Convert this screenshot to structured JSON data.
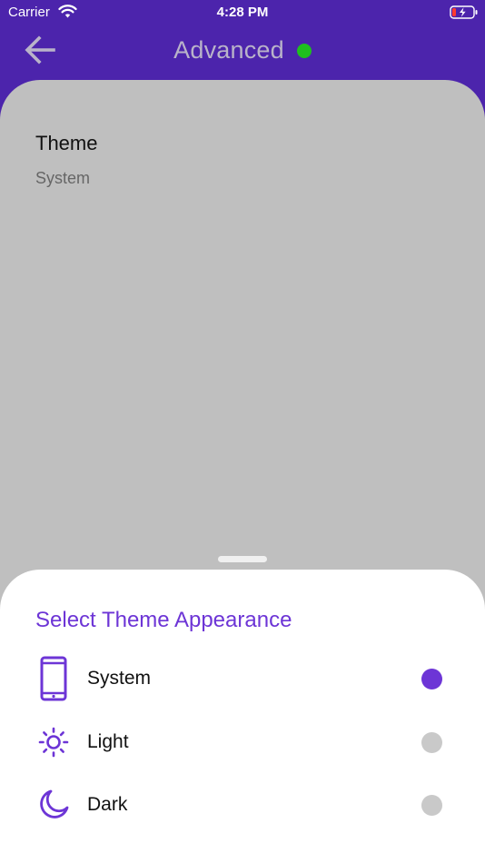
{
  "status_bar": {
    "carrier": "Carrier",
    "time": "4:28 PM",
    "wifi_icon": "wifi-icon",
    "battery_icon": "battery-charging-icon"
  },
  "header": {
    "title": "Advanced",
    "back_icon": "arrow-left-icon",
    "status_dot_color": "#1fbf1f"
  },
  "settings": {
    "theme": {
      "title": "Theme",
      "value": "System"
    }
  },
  "theme_sheet": {
    "title": "Select Theme Appearance",
    "options": [
      {
        "label": "System",
        "icon": "smartphone-icon",
        "selected": true
      },
      {
        "label": "Light",
        "icon": "sun-icon",
        "selected": false
      },
      {
        "label": "Dark",
        "icon": "moon-icon",
        "selected": false
      }
    ]
  },
  "colors": {
    "header_bg": "#4c24ac",
    "accent": "#6d35d6",
    "overlay_bg": "#bfbfbf"
  }
}
